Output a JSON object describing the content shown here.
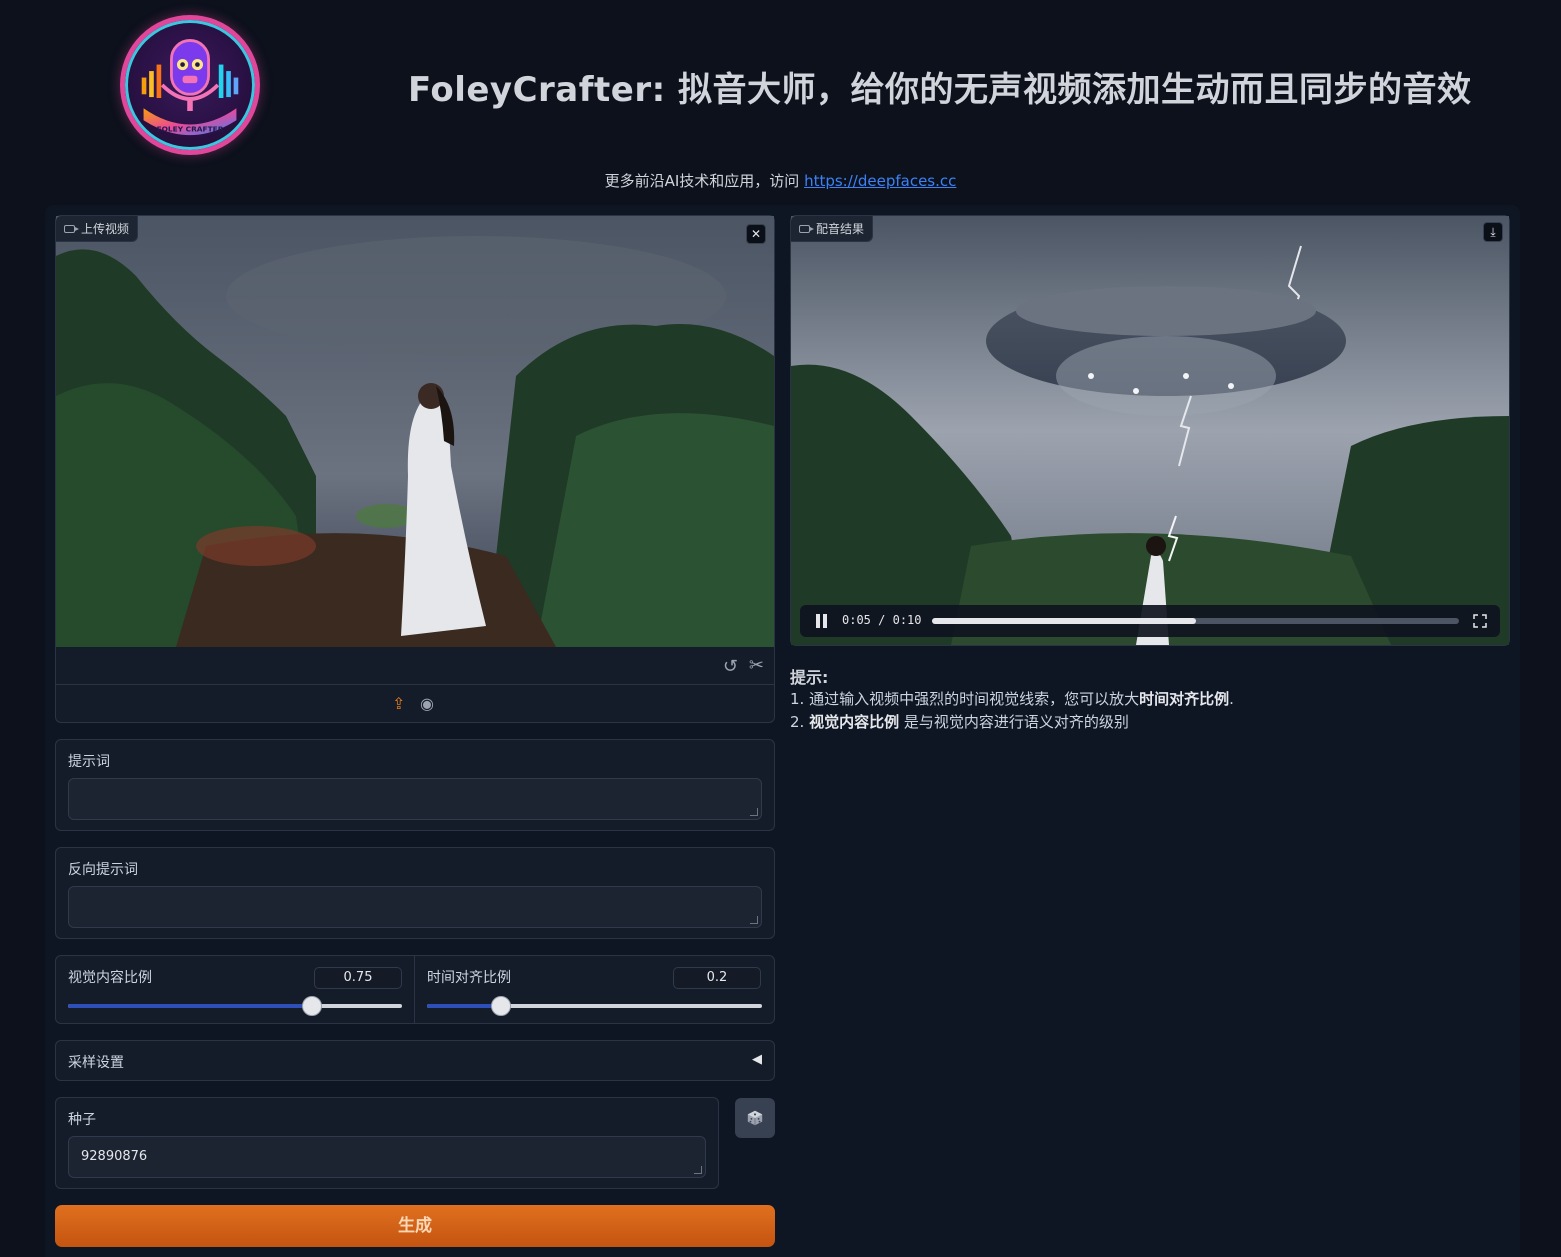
{
  "header": {
    "title": "FoleyCrafter: 拟音大师，给你的无声视频添加生动而且同步的音效",
    "subtitle_prefix": "更多前沿AI技术和应用，访问",
    "subtitle_link": "https://deepfaces.cc",
    "logo_text": "FOLEY CRAFTER"
  },
  "upload": {
    "label": "上传视频",
    "close_icon": "close-icon",
    "tool_icons": [
      "undo-icon",
      "scissors-icon"
    ],
    "source_icons": [
      "upload-icon",
      "webcam-icon"
    ]
  },
  "result": {
    "label": "配音结果",
    "download_icon": "download-icon",
    "player": {
      "current_time": "0:05",
      "separator": "/",
      "duration": "0:10",
      "progress": 0.5
    }
  },
  "tips": {
    "title": "提示:",
    "item1_prefix": "1. 通过输入视频中强烈的时间视觉线索，您可以放大",
    "item1_bold": "时间对齐比例",
    "item1_suffix": ".",
    "item2_prefix": "2. ",
    "item2_bold": "视觉内容比例",
    "item2_suffix": " 是与视觉内容进行语义对齐的级别"
  },
  "prompt": {
    "label": "提示词",
    "value": ""
  },
  "negative_prompt": {
    "label": "反向提示词",
    "value": ""
  },
  "sliders": {
    "visual": {
      "label": "视觉内容比例",
      "value": "0.75",
      "fraction": 0.73
    },
    "temporal": {
      "label": "时间对齐比例",
      "value": "0.2",
      "fraction": 0.22
    }
  },
  "sampling": {
    "label": "采样设置",
    "arrow": "◀"
  },
  "seed": {
    "label": "种子",
    "value": "92890876",
    "dice_icon": "dice-icon"
  },
  "generate": {
    "label": "生成"
  },
  "colors": {
    "accent": "#d9621a",
    "slider": "#2f4fb8",
    "background": "#0c111c"
  }
}
